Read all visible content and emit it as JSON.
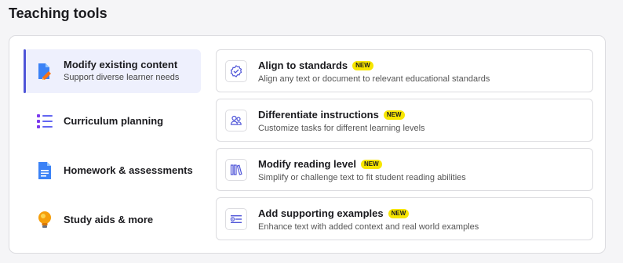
{
  "page": {
    "title": "Teaching tools"
  },
  "categories": [
    {
      "label": "Modify existing content",
      "sublabel": "Support diverse learner needs",
      "active": true,
      "icon": "edit-document-icon"
    },
    {
      "label": "Curriculum planning",
      "sublabel": "",
      "active": false,
      "icon": "list-icon"
    },
    {
      "label": "Homework & assessments",
      "sublabel": "",
      "active": false,
      "icon": "document-icon"
    },
    {
      "label": "Study aids & more",
      "sublabel": "",
      "active": false,
      "icon": "lightbulb-icon"
    }
  ],
  "tools": [
    {
      "title": "Align to standards",
      "badge": "NEW",
      "description": "Align any text or document to relevant educational standards",
      "icon": "check-badge-icon"
    },
    {
      "title": "Differentiate instructions",
      "badge": "NEW",
      "description": "Customize tasks for different learning levels",
      "icon": "people-icon"
    },
    {
      "title": "Modify reading level",
      "badge": "NEW",
      "description": "Simplify or challenge text to fit student reading abilities",
      "icon": "books-icon"
    },
    {
      "title": "Add supporting examples",
      "badge": "NEW",
      "description": "Enhance text with added context and real world examples",
      "icon": "text-add-icon"
    }
  ],
  "colors": {
    "accent": "#4f55d8",
    "badge": "#f7e600",
    "active_bg": "#eef0fd"
  }
}
